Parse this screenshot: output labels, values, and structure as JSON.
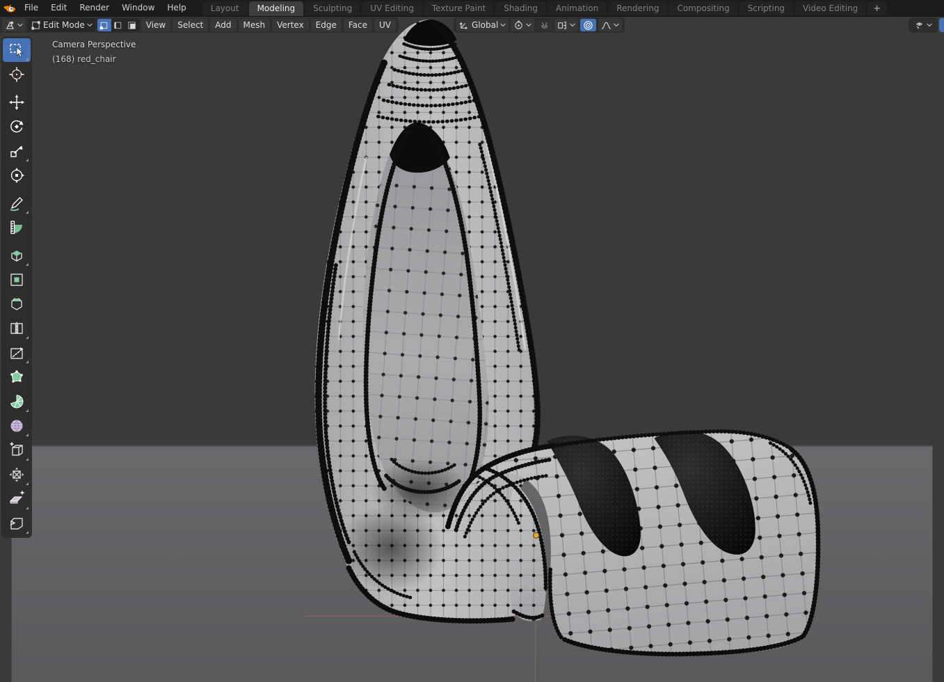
{
  "app": {
    "title": "Blender"
  },
  "topbar": {
    "menus": [
      "File",
      "Edit",
      "Render",
      "Window",
      "Help"
    ],
    "tabs": [
      "Layout",
      "Modeling",
      "Sculpting",
      "UV Editing",
      "Texture Paint",
      "Shading",
      "Animation",
      "Rendering",
      "Compositing",
      "Scripting",
      "Video Editing"
    ],
    "active_tab": "Modeling",
    "add_tab_label": "+"
  },
  "viewport_header": {
    "editor_icon": "editor-3d-viewport-icon",
    "mode_select": {
      "value": "Edit Mode",
      "icon": "edit-mode-cube-icon"
    },
    "select_mode_icons": [
      "vertex-select-icon",
      "edge-select-icon",
      "face-select-icon"
    ],
    "active_select_mode": "vertex-select",
    "menus": [
      "View",
      "Select",
      "Add",
      "Mesh",
      "Vertex",
      "Edge",
      "Face",
      "UV"
    ],
    "transform_orientation": {
      "value": "Global",
      "icon": "orientation-axes-icon"
    },
    "pivot_icon": "pivot-point-icon",
    "snap_icons": [
      "snap-magnet-icon",
      "snap-target-icon"
    ],
    "snap_enabled": false,
    "proportional_editing_icon": "proportional-editing-bullseye-icon",
    "proportional_editing_enabled": true,
    "falloff_icon": "falloff-curve-icon",
    "gizmo_icon": "gizmo-visibility-icon"
  },
  "toolbar": {
    "active_tool": "Select Box",
    "tools": [
      "Select Box",
      "Cursor",
      "Move",
      "Rotate",
      "Scale",
      "Transform",
      "Annotate",
      "Measure",
      "Extrude Region",
      "Inset Faces",
      "Bevel",
      "Loop Cut",
      "Knife",
      "Poly Build",
      "Spin",
      "Smooth",
      "Edge Slide",
      "Shrink/Fatten",
      "Shear",
      "Rip Region"
    ]
  },
  "viewport": {
    "view_label": "Camera Perspective",
    "object_label": "(168) red_chair",
    "object_name": "red_chair",
    "vertex_count_label": "(168)"
  },
  "colors": {
    "accent_blue": "#4772b3",
    "topbar_bg": "#1c1c1c",
    "header_pill_bg": "#2d2d2d",
    "toolshelf_bg": "#2d2d2d",
    "sky": "#3a3a3b",
    "ground": "#646467",
    "mesh_surface": "#b8b8ba",
    "wire_dot": "#141414",
    "origin_orange": "#e8a33d",
    "axis_x_red": "#a85c5c",
    "axis_y_green": "#6d7a57",
    "tool_green": "#83cba0",
    "tool_purple": "#cfc0e0"
  }
}
